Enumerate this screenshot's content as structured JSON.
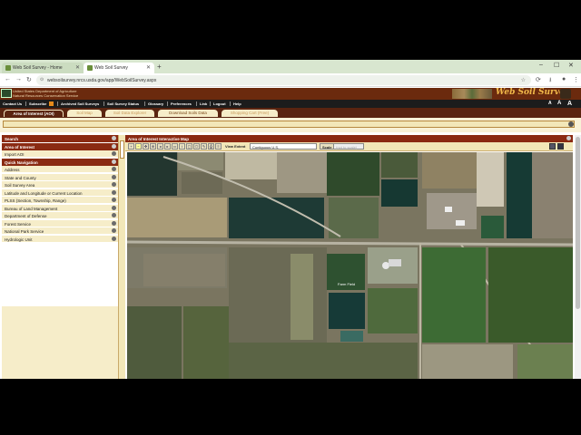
{
  "browser": {
    "tabs": [
      {
        "label": "Web Soil Survey - Home"
      },
      {
        "label": "Web Soil Survey"
      }
    ],
    "new_tab_label": "+",
    "url": "websoilsurvey.nrcs.usda.gov/app/WebSoilSurvey.aspx"
  },
  "banner": {
    "agency": "United States Department of Agriculture",
    "agency2": "Natural Resources Conservation Service",
    "title": "Web Soil Survey"
  },
  "menu": {
    "items": [
      "Contact Us",
      "Subscribe",
      "Archived Soil Surveys",
      "Soil Survey Status",
      "Glossary",
      "Preferences",
      "Link",
      "Logout",
      "Help"
    ],
    "size_buttons": [
      "A",
      "A",
      "A"
    ]
  },
  "aoi_tabs": [
    {
      "label": "Area of Interest (AOI)",
      "state": "active"
    },
    {
      "label": "Soil Map",
      "state": "dim"
    },
    {
      "label": "Soil Data Explorer",
      "state": "dim"
    },
    {
      "label": "Download Soils Data",
      "state": "inactive"
    },
    {
      "label": "Shopping Cart (Free)",
      "state": "dim"
    }
  ],
  "left_panel": {
    "search_header": "Search",
    "aoi_header": "Area of Interest",
    "aoi_items": [
      "Import AOI"
    ],
    "quick_nav_header": "Quick Navigation",
    "quick_nav_items": [
      "Address",
      "State and County",
      "Soil Survey Area",
      "Latitude and Longitude or Current Location",
      "PLSS (Section, Township, Range)",
      "Bureau of Land Management",
      "Department of Defense",
      "Forest Service",
      "National Park Service",
      "Hydrologic Unit"
    ]
  },
  "map_panel": {
    "title": "Area of Interest Interactive Map",
    "view_extent_label": "View Extent",
    "view_extent_value": "Contiguous U.S.",
    "scale_label": "Scale",
    "scale_value": "(not to scale)",
    "place_label": "Farm Field"
  },
  "colors": {
    "banner": "#6b2a0e",
    "header": "#8a2a12",
    "panel_bg": "#f6edc9",
    "accent": "#f1b94a"
  }
}
